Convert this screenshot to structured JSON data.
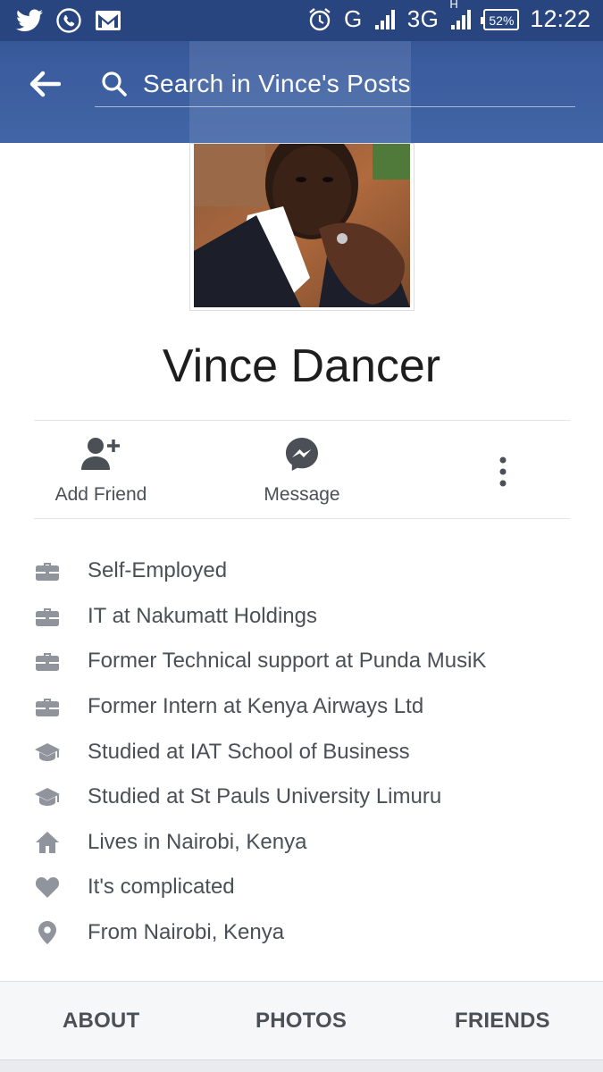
{
  "status_bar": {
    "network_type": "G",
    "network_type_2": "3G",
    "network_badge": "H",
    "battery": "52%",
    "time": "12:22",
    "icons": [
      "twitter-icon",
      "whatsapp-icon",
      "gmail-icon",
      "alarm-icon",
      "signal-icon",
      "battery-icon"
    ]
  },
  "header": {
    "search_placeholder": "Search in Vince's Posts",
    "colors": {
      "bar": "#3b5c9e",
      "status": "#28457f"
    }
  },
  "profile": {
    "name": "Vince Dancer"
  },
  "actions": {
    "add_friend": "Add Friend",
    "message": "Message"
  },
  "info": [
    {
      "icon": "briefcase-icon",
      "text": "Self-Employed"
    },
    {
      "icon": "briefcase-icon",
      "text": "IT at Nakumatt Holdings"
    },
    {
      "icon": "briefcase-icon",
      "text": "Former Technical support at Punda MusiK"
    },
    {
      "icon": "briefcase-icon",
      "text": "Former Intern at Kenya Airways Ltd"
    },
    {
      "icon": "graduation-cap-icon",
      "text": "Studied at IAT School of Business"
    },
    {
      "icon": "graduation-cap-icon",
      "text": "Studied at St Pauls University Limuru"
    },
    {
      "icon": "home-icon",
      "text": "Lives in Nairobi, Kenya"
    },
    {
      "icon": "heart-icon",
      "text": "It's complicated"
    },
    {
      "icon": "location-pin-icon",
      "text": "From Nairobi, Kenya"
    }
  ],
  "tabs": {
    "about": "ABOUT",
    "photos": "PHOTOS",
    "friends": "FRIENDS"
  },
  "colors": {
    "text_primary": "#1d1d1d",
    "text_secondary": "#4b4f56",
    "icon_gray": "#90949c"
  }
}
